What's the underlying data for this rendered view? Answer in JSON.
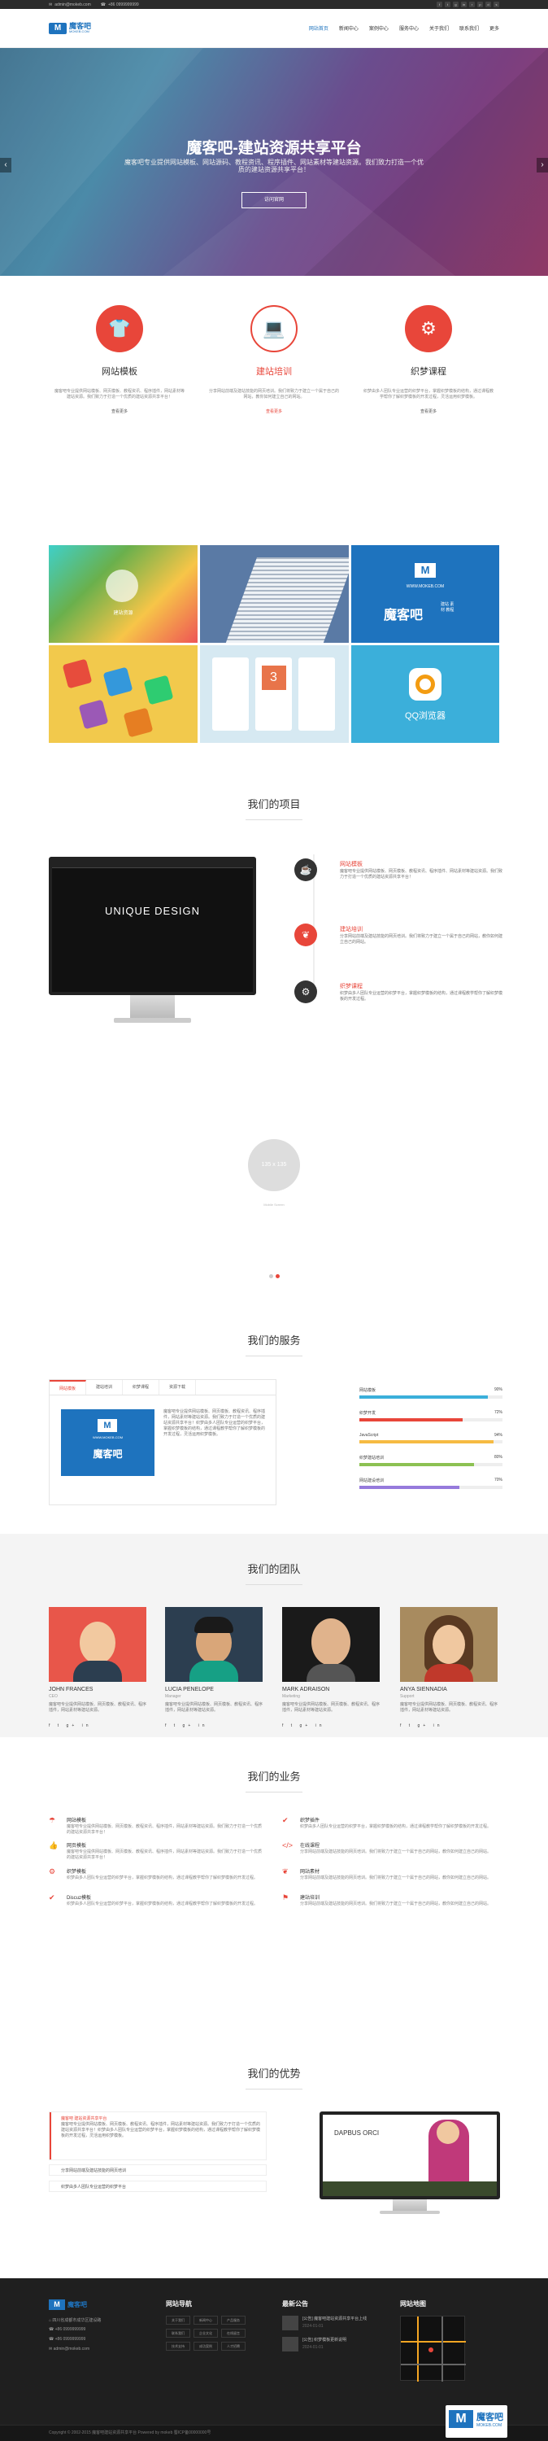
{
  "topbar": {
    "email": "admin@mokeb.com",
    "phone": "+86 0999999999"
  },
  "brand": {
    "name": "魔客吧",
    "sub": "MOKEB.COM",
    "mark": "M"
  },
  "nav": [
    "网站首页",
    "新闻中心",
    "案例中心",
    "服务中心",
    "关于我们",
    "联系我们",
    "更多"
  ],
  "hero": {
    "title": "魔客吧-建站资源共享平台",
    "desc": "魔客吧专业提供网站模板、网站源码、教程资讯、程序插件、网站素材等建站资源。我们致力打造一个优质的建站资源共享平台！",
    "button": "访问官网"
  },
  "features": [
    {
      "title": "网站模板",
      "desc": "魔客吧专业提供网站模板、网页模板、教程资讯、程序插件，网站素材等建站资源。我们致力于打造一个优质的建站资源共享平台！",
      "more": "查看更多",
      "color": "#e8463a",
      "icon": "shirt-icon"
    },
    {
      "title": "建站培训",
      "desc": "分享网站前端及建站技能的网页培训。我们将致力于建立一个属于自己的网站，教你如何建立自己的网站。",
      "more": "查看更多",
      "color": "#e8463a",
      "icon": "laptop-icon"
    },
    {
      "title": "织梦课程",
      "desc": "织梦由多人团队专业运营的织梦平台，掌握织梦模板的结构，通过课程教学帮你了解织梦模板的开发过程，灵活运用织梦模板。",
      "more": "查看更多",
      "color": "#e8463a",
      "icon": "gear-icon"
    }
  ],
  "tiles": {
    "brand_big": "魔客吧",
    "brand_tag": "建站资源",
    "site": "WWW.MOKEB.COM",
    "tagline1": "建站",
    "tagline2": "素材",
    "tagline3": "教程",
    "calendar": "3",
    "qq": "QQ浏览器"
  },
  "projects": {
    "title": "我们的项目",
    "mock_title": "UNIQUE DESIGN",
    "items": [
      {
        "title": "网站模板",
        "desc": "魔客吧专业提供网站模板、网页模板、教程资讯、程序插件、网站素材等建站资源。我们致力于打造一个优质的建站资源共享平台！",
        "color": "#333",
        "icon": "cup-icon"
      },
      {
        "title": "建站培训",
        "desc": "分享网站前端及建站技能的网页培训。我们将致力于建立一个属于自己的网站，教你如何建立自己的网站。",
        "color": "#e8463a",
        "icon": "leaf-icon"
      },
      {
        "title": "织梦课程",
        "desc": "织梦由多人团队专业运营的织梦平台，掌握织梦模板的结构，通过课程教学帮你了解织梦模板的开发过程。",
        "color": "#333",
        "icon": "cog-icon"
      }
    ]
  },
  "placeholder": {
    "size": "135 x 135",
    "caption": "Mobile Screen"
  },
  "services": {
    "title": "我们的服务",
    "tabs": [
      "网站模板",
      "建站培训",
      "织梦课程",
      "资源下载"
    ],
    "tab_text": "魔客吧专业提供网站模板、网页模板、教程资讯、程序插件，网站素材等建站资源。我们致力于打造一个优质的建站资源共享平台！织梦由多人团队专业运营的织梦平台，掌握织梦模板的结构，通过课程教学帮你了解织梦模板的开发过程，灵活运用织梦模板。",
    "logo_text": "魔客吧",
    "logo_site": "WWW.MOKEB.COM",
    "skills": [
      {
        "name": "网站模板",
        "value": 90,
        "color": "#3bafda"
      },
      {
        "name": "织梦开发",
        "value": 72,
        "color": "#e8463a"
      },
      {
        "name": "JavaScript",
        "value": 94,
        "color": "#f6bb42"
      },
      {
        "name": "织梦建站培训",
        "value": 80,
        "color": "#8cc152"
      },
      {
        "name": "网站建设培训",
        "value": 70,
        "color": "#967adc"
      }
    ]
  },
  "team": {
    "title": "我们的团队",
    "members": [
      {
        "name": "JOHN FRANCES",
        "role": "CEO",
        "desc": "魔客吧专业提供网站模板、网页模板、教程资讯、程序插件，网站素材等建站资源。"
      },
      {
        "name": "LUCIA PENELOPE",
        "role": "Manager",
        "desc": "魔客吧专业提供网站模板、网页模板、教程资讯、程序插件，网站素材等建站资源。"
      },
      {
        "name": "MARK ADRAISON",
        "role": "Marketing",
        "desc": "魔客吧专业提供网站模板、网页模板、教程资讯、程序插件，网站素材等建站资源。"
      },
      {
        "name": "ANYA SIENNADIA",
        "role": "Support",
        "desc": "魔客吧专业提供网站模板、网页模板、教程资讯、程序插件，网站素材等建站资源。"
      }
    ],
    "social": "f  t  g+  in"
  },
  "business": {
    "title": "我们的业务",
    "items": [
      {
        "title": "网站模板",
        "desc": "魔客吧专业提供网站模板、网页模板、教程资讯、程序插件，网站素材等建站资源。我们致力于打造一个优质的建站资源共享平台！",
        "icon": "umbrella-icon"
      },
      {
        "title": "织梦插件",
        "desc": "织梦由多人团队专业运营的织梦平台，掌握织梦模板的结构，通过课程教学帮你了解织梦模板的开发过程。",
        "icon": "check-icon"
      },
      {
        "title": "网页模板",
        "desc": "魔客吧专业提供网站模板、网页模板、教程资讯、程序插件，网站素材等建站资源。我们致力于打造一个优质的建站资源共享平台！",
        "icon": "thumb-icon"
      },
      {
        "title": "在线课程",
        "desc": "分享网站前端及建站技能的网页培训。我们将致力于建立一个属于自己的网站，教你如何建立自己的网站。",
        "icon": "code-icon"
      },
      {
        "title": "织梦模板",
        "desc": "织梦由多人团队专业运营的织梦平台，掌握织梦模板的结构，通过课程教学帮你了解织梦模板的开发过程。",
        "icon": "gear-icon"
      },
      {
        "title": "网站素材",
        "desc": "分享网站前端及建站技能的网页培训。我们将致力于建立一个属于自己的网站，教你如何建立自己的网站。",
        "icon": "leaf-icon"
      },
      {
        "title": "Discuz模板",
        "desc": "织梦由多人团队专业运营的织梦平台，掌握织梦模板的结构，通过课程教学帮你了解织梦模板的开发过程。",
        "icon": "check-icon"
      },
      {
        "title": "建站培训",
        "desc": "分享网站前端及建站技能的网页培训。我们将致力于建立一个属于自己的网站，教你如何建立自己的网站。",
        "icon": "flag-icon"
      }
    ]
  },
  "advantages": {
    "title": "我们的优势",
    "panel_title": "魔客吧 建站资源共享平台",
    "panel_text": "魔客吧专业提供网站模板、网页模板、教程资讯、程序插件，网站素材等建站资源。我们致力于打造一个优质的建站资源共享平台！织梦由多人团队专业运营的织梦平台，掌握织梦模板的结构，通过课程教学帮你了解织梦模板的开发过程，灵活运用织梦模板。",
    "q2": "分享网站前端及建站技能的网页培训",
    "q3": "织梦由多人团队专业运营的织梦平台",
    "mock": "DAPBUS ORCI"
  },
  "footer": {
    "contact": [
      "四川省成都市成华区建设路",
      "+86 0999999999",
      "+86 0999999999",
      "admin@mokeb.com"
    ],
    "nav_title": "网站导航",
    "nav": [
      "关于我们",
      "新闻中心",
      "产品服务",
      "联系我们",
      "企业文化",
      "在线留言",
      "技术支持",
      "成功案例",
      "人才招聘"
    ],
    "news_title": "最新公告",
    "news": [
      {
        "t": "[公告] 魔客吧建站资源共享平台上线",
        "d": "2024-01-01"
      },
      {
        "t": "[公告] 织梦模板更新说明",
        "d": "2024-01-01"
      }
    ],
    "map_title": "网站地图",
    "copyright": "Copyright © 2002-2015 魔客吧建站资源共享平台 Powered by mokeb 蜀ICP备00000000号",
    "watermark": "魔客吧",
    "watermark_site": "MOKEB.COM"
  }
}
